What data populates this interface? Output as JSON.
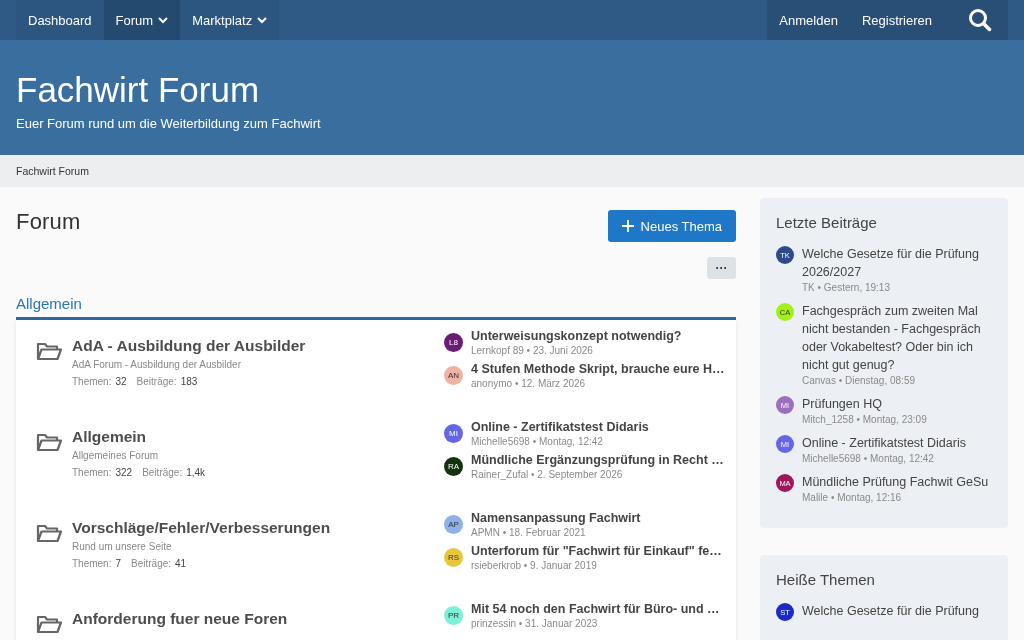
{
  "nav": {
    "left": [
      {
        "label": "Dashboard",
        "selected": false,
        "dropdown": false
      },
      {
        "label": "Forum",
        "selected": true,
        "dropdown": true
      },
      {
        "label": "Marktplatz",
        "selected": false,
        "dropdown": true
      }
    ],
    "right": [
      "Anmelden",
      "Registrieren"
    ]
  },
  "header": {
    "title": "Fachwirt Forum",
    "tagline": "Euer Forum rund um die Weiterbildung zum Fachwirt"
  },
  "breadcrumb": "Fachwirt Forum",
  "page": {
    "title": "Forum",
    "new_button": "Neues Thema",
    "more_button": "···"
  },
  "category": {
    "title": "Allgemein",
    "forums": [
      {
        "name": "AdA - Ausbildung der Ausbilder",
        "description": "AdA Forum - Ausbildung der Ausbilder",
        "stats": [
          {
            "label": "Themen:",
            "value": "32"
          },
          {
            "label": "Beiträge:",
            "value": "183"
          }
        ],
        "latest": [
          {
            "initials": "L8",
            "color": "#6a1b7a",
            "title": "Unterweisungskonzept notwendig?",
            "meta": "Lernkopf 89 • 23. Juni 2026"
          },
          {
            "initials": "AN",
            "color": "#f0b3a3",
            "title": "4 Stufen Methode Skript, brauche eure H…",
            "meta": "anonymo • 12. März 2026"
          }
        ]
      },
      {
        "name": "Allgemein",
        "description": "Allgemeines Forum",
        "stats": [
          {
            "label": "Themen:",
            "value": "322"
          },
          {
            "label": "Beiträge:",
            "value": "1,4k"
          }
        ],
        "latest": [
          {
            "initials": "MI",
            "color": "#6466e6",
            "title": "Online - Zertifikatstest Didaris",
            "meta": "Michelle5698 • Montag, 12:42"
          },
          {
            "initials": "RA",
            "color": "#13330f",
            "title": "Mündliche Ergänzungsprüfung in Recht …",
            "meta": "Rainer_Zufal • 2. September 2026"
          }
        ]
      },
      {
        "name": "Vorschläge/Fehler/Verbesserungen",
        "description": "Rund um unsere Seite",
        "stats": [
          {
            "label": "Themen:",
            "value": "7"
          },
          {
            "label": "Beiträge:",
            "value": "41"
          }
        ],
        "latest": [
          {
            "initials": "AP",
            "color": "#8eb1e8",
            "title": "Namensanpassung Fachwirt",
            "meta": "APMN • 18. Februar 2021"
          },
          {
            "initials": "RS",
            "color": "#e8c83a",
            "title": "Unterforum für \"Fachwirt für Einkauf\" fe…",
            "meta": "rsieberkrob • 9. Januar 2019"
          }
        ]
      },
      {
        "name": "Anforderung fuer neue Foren",
        "latest": [
          {
            "initials": "PR",
            "color": "#7ff0d8",
            "title": "Mit 54 noch den Fachwirt für Büro- und …",
            "meta": "prinzessin • 31. Januar 2023"
          }
        ]
      }
    ]
  },
  "sidebar": [
    {
      "title": "Letzte Beiträge",
      "posts": [
        {
          "initials": "TK",
          "color": "#2d4b8a",
          "title": "Welche Gesetze für die Prüfung 2026/2027",
          "meta": "TK • Gestern, 19:13"
        },
        {
          "initials": "CA",
          "color": "#a4ee18",
          "title": "Fachgespräch zum zweiten Mal nicht bestanden - Fachgespräch oder Vokabeltest? Oder bin ich nicht gut genug?",
          "meta": "Canvas • Dienstag, 08:59"
        },
        {
          "initials": "MI",
          "color": "#9b6fbd",
          "title": "Prüfungen HQ",
          "meta": "Mitch_1258 • Montag, 23:09"
        },
        {
          "initials": "MI",
          "color": "#6466e6",
          "title": "Online - Zertifikatstest Didaris",
          "meta": "Michelle5698 • Montag, 12:42"
        },
        {
          "initials": "MA",
          "color": "#a0165a",
          "title": "Mündliche Prüfung Fachwit GeSu",
          "meta": "Malile • Montag, 12:16"
        }
      ]
    },
    {
      "title": "Heiße Themen",
      "posts": [
        {
          "initials": "ST",
          "color": "#1a2bc4",
          "title": "Welche Gesetze für die Prüfung"
        }
      ]
    }
  ]
}
